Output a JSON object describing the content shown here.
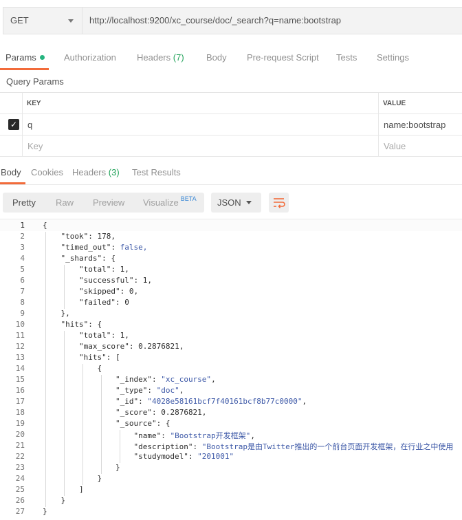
{
  "request": {
    "method": "GET",
    "url": "http://localhost:9200/xc_course/doc/_search?q=name:bootstrap"
  },
  "request_tabs": [
    {
      "label": "Params",
      "active": true
    },
    {
      "label": "Authorization"
    },
    {
      "label": "Headers",
      "count": "(7)"
    },
    {
      "label": "Body"
    },
    {
      "label": "Pre-request Script"
    },
    {
      "label": "Tests"
    },
    {
      "label": "Settings"
    }
  ],
  "query_params": {
    "title": "Query Params",
    "columns": {
      "key": "KEY",
      "value": "VALUE"
    },
    "rows": [
      {
        "checked": true,
        "key": "q",
        "value": "name:bootstrap"
      }
    ],
    "placeholder": {
      "key": "Key",
      "value": "Value"
    }
  },
  "response_tabs": [
    {
      "label": "Body",
      "active": true
    },
    {
      "label": "Cookies"
    },
    {
      "label": "Headers",
      "count": "(3)"
    },
    {
      "label": "Test Results"
    }
  ],
  "view_modes": [
    "Pretty",
    "Raw",
    "Preview",
    "Visualize"
  ],
  "beta_badge": "BETA",
  "format": "JSON",
  "code_lines": [
    "{",
    "    \"took\": 178,",
    "    \"timed_out\": false,",
    "    \"_shards\": {",
    "        \"total\": 1,",
    "        \"successful\": 1,",
    "        \"skipped\": 0,",
    "        \"failed\": 0",
    "    },",
    "    \"hits\": {",
    "        \"total\": 1,",
    "        \"max_score\": 0.2876821,",
    "        \"hits\": [",
    "            {",
    "                \"_index\": \"xc_course\",",
    "                \"_type\": \"doc\",",
    "                \"_id\": \"4028e58161bcf7f40161bcf8b77c0000\",",
    "                \"_score\": 0.2876821,",
    "                \"_source\": {",
    "                    \"name\": \"Bootstrap开发框架\",",
    "                    \"description\": \"Bootstrap是由Twitter推出的一个前台页面开发框架，在行业之中使用",
    "                    \"studymodel\": \"201001\"",
    "                }",
    "            }",
    "        ]",
    "    }",
    "}"
  ],
  "colors": {
    "accent": "#f26b3a",
    "active_dot": "#26b47f",
    "count_green": "#22a35a",
    "string": "#3a56a6"
  },
  "icons": [
    "chevron-down-icon",
    "checkbox-checked-icon",
    "wrap-lines-icon"
  ]
}
